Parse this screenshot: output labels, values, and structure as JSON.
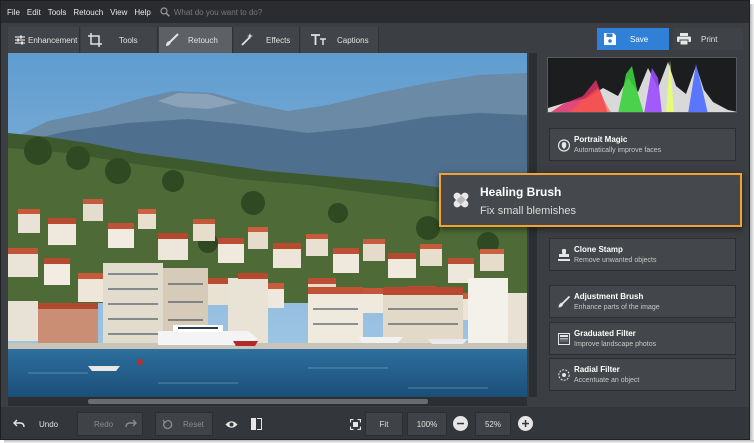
{
  "menu": {
    "items": [
      "File",
      "Edit",
      "Tools",
      "Retouch",
      "View",
      "Help"
    ],
    "search_placeholder": "What do you want to do?"
  },
  "tabs": [
    {
      "label": "Enhancement",
      "icon": "sliders-icon"
    },
    {
      "label": "Tools",
      "icon": "crop-icon"
    },
    {
      "label": "Retouch",
      "icon": "brush-icon",
      "active": true
    },
    {
      "label": "Effects",
      "icon": "magic-wand-icon"
    },
    {
      "label": "Captions",
      "icon": "text-icon"
    }
  ],
  "toolbar": {
    "save_label": "Save",
    "print_label": "Print"
  },
  "tools": [
    {
      "title": "Portrait Magic",
      "subtitle": "Automatically improve faces",
      "icon": "portrait-icon"
    },
    {
      "title": "Clone Stamp",
      "subtitle": "Remove unwanted objects",
      "icon": "stamp-icon"
    },
    {
      "title": "Adjustment Brush",
      "subtitle": "Enhance parts of the image",
      "icon": "brush-icon"
    },
    {
      "title": "Graduated Filter",
      "subtitle": "Improve landscape photos",
      "icon": "graduated-filter-icon"
    },
    {
      "title": "Radial Filter",
      "subtitle": "Accentuate an object",
      "icon": "radial-filter-icon"
    }
  ],
  "popup": {
    "title": "Healing Brush",
    "subtitle": "Fix small blemishes",
    "icon": "bandage-icon"
  },
  "bottom": {
    "undo_label": "Undo",
    "redo_label": "Redo",
    "reset_label": "Reset",
    "fit_label": "Fit",
    "zoom_100_label": "100%",
    "zoom_value": "52%"
  },
  "colors": {
    "accent": "#2f80d6",
    "highlight": "#f2a22e",
    "panel": "#3b3e42"
  }
}
